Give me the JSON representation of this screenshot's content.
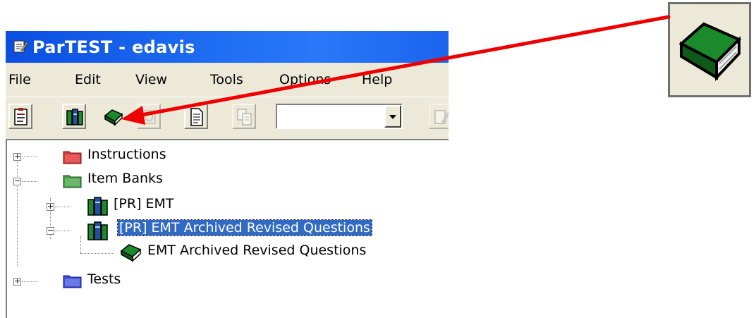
{
  "window": {
    "title": "ParTEST - edavis"
  },
  "menu": {
    "items": [
      "File",
      "Edit",
      "View",
      "Tools",
      "Options",
      "Help"
    ]
  },
  "toolbar": {
    "buttons": [
      "properties-icon",
      "item-banks-icon",
      "item-bank-icon",
      "disabled-icon",
      "document-icon",
      "copy-icon"
    ],
    "combo_value": ""
  },
  "tree": {
    "instructions": "Instructions",
    "item_banks": "Item Banks",
    "pr_emt": "[PR] EMT",
    "pr_emt_archived": "[PR] EMT Archived Revised Questions",
    "emt_archived": "EMT Archived Revised Questions",
    "tests": "Tests"
  },
  "colors": {
    "titlebar": "#0b4ee0",
    "selection": "#316ac5",
    "arrow": "#ee0000",
    "book_green": "#1a8a2a"
  }
}
